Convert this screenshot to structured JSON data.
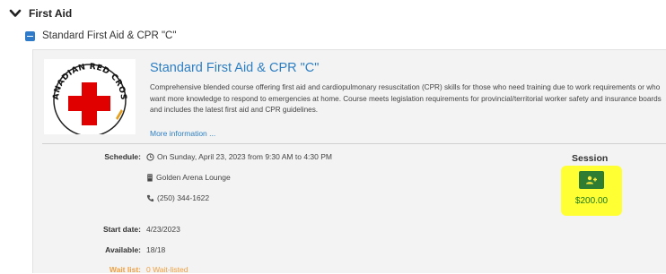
{
  "category": {
    "title": "First Aid"
  },
  "course": {
    "row_label": "Standard First Aid & CPR \"C\"",
    "title": "Standard First Aid & CPR \"C\"",
    "description": "Comprehensive blended course offering first aid and cardiopulmonary resuscitation (CPR) skills for those who need training due to work requirements or who want more knowledge to respond to emergencies at home. Course meets legislation requirements for provincial/territorial worker safety and insurance boards and includes the latest first aid and CPR guidelines.",
    "more_info": "More information ...",
    "logo_text": "CANADIAN RED CROSS"
  },
  "schedule": {
    "label": "Schedule:",
    "when": "On Sunday, April 23, 2023 from 9:30 AM to 4:30 PM",
    "location": "Golden Arena Lounge",
    "phone": "(250) 344-1622"
  },
  "start_date": {
    "label": "Start date:",
    "value": "4/23/2023"
  },
  "available": {
    "label": "Available:",
    "value": "18/18"
  },
  "wait_list": {
    "label": "Wait list:",
    "value": "0 Wait-listed"
  },
  "session": {
    "header": "Session",
    "price": "$200.00"
  },
  "colors": {
    "link": "#2d7fc4",
    "enroll_button": "#2e7d32",
    "highlight": "#ffff33",
    "price": "#1b7a1b"
  }
}
